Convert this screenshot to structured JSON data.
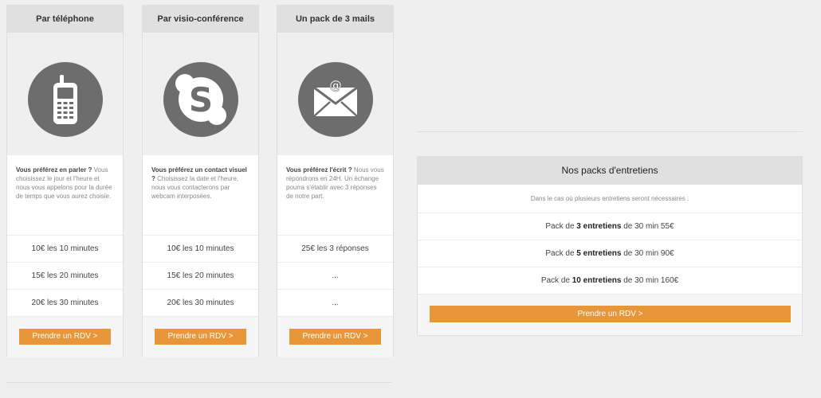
{
  "cards": [
    {
      "title": "Par téléphone",
      "icon": "phone-icon",
      "desc_strong": "Vous préférez en parler ?",
      "desc_text": " Vous choisissez le jour et l'heure et nous vous appelons pour la durée de temps que vous aurez choisie.",
      "prices": [
        "10€ les 10 minutes",
        "15€ les 20 minutes",
        "20€ les 30 minutes"
      ],
      "button": "Prendre un RDV >"
    },
    {
      "title": "Par visio-conférence",
      "icon": "skype-icon",
      "desc_strong": "Vous préférez un contact visuel ?",
      "desc_text": " Choisissez la date et l'heure, nous vous contacterons par webcam interposées.",
      "prices": [
        "10€ les 10 minutes",
        "15€ les 20 minutes",
        "20€ les 30 minutes"
      ],
      "button": "Prendre un RDV >"
    },
    {
      "title": "Un pack de 3 mails",
      "icon": "mail-icon",
      "desc_strong": "Vous préférez l'écrit ?",
      "desc_text": " Nous vous répondrons en 24H. Un échange pourra s'établir avec 3 réponses de notre part.",
      "prices": [
        "25€ les 3 réponses",
        "...",
        "..."
      ],
      "button": "Prendre un RDV >"
    }
  ],
  "packs": {
    "title": "Nos packs d'entretiens",
    "subtitle": "Dans le cas où plusieurs entretiens seront nécessaires :",
    "rows": [
      {
        "prefix": "Pack de ",
        "strong": "3 entretiens",
        "suffix": " de 30 min 55€"
      },
      {
        "prefix": "Pack de ",
        "strong": "5 entretiens",
        "suffix": " de 30 min 90€"
      },
      {
        "prefix": "Pack de ",
        "strong": "10 entretiens",
        "suffix": " de 30 min 160€"
      }
    ],
    "button": "Prendre un RDV >"
  },
  "colors": {
    "accent": "#e8963a",
    "icon_circle": "#6d6d6d",
    "background": "#efefef"
  }
}
